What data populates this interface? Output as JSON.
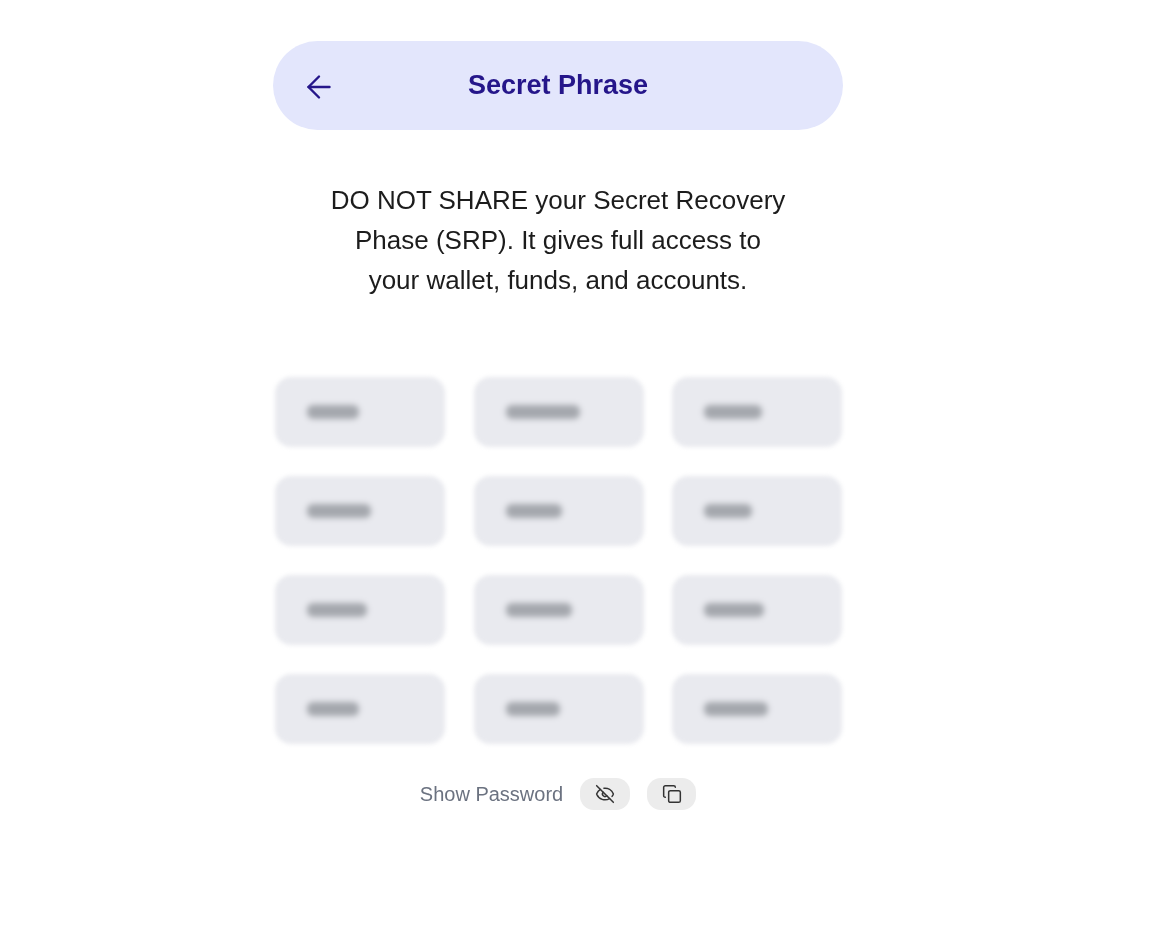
{
  "header": {
    "title": "Secret Phrase"
  },
  "warning": "DO NOT SHARE your Secret Recovery Phase (SRP). It gives full access to your wallet, funds, and accounts.",
  "phrase": {
    "revealed": false,
    "tiles": [
      {
        "blurred": true
      },
      {
        "blurred": true
      },
      {
        "blurred": true
      },
      {
        "blurred": true
      },
      {
        "blurred": true
      },
      {
        "blurred": true
      },
      {
        "blurred": true
      },
      {
        "blurred": true
      },
      {
        "blurred": true
      },
      {
        "blurred": true
      },
      {
        "blurred": true
      },
      {
        "blurred": true
      }
    ]
  },
  "show_password": {
    "label": "Show Password"
  }
}
